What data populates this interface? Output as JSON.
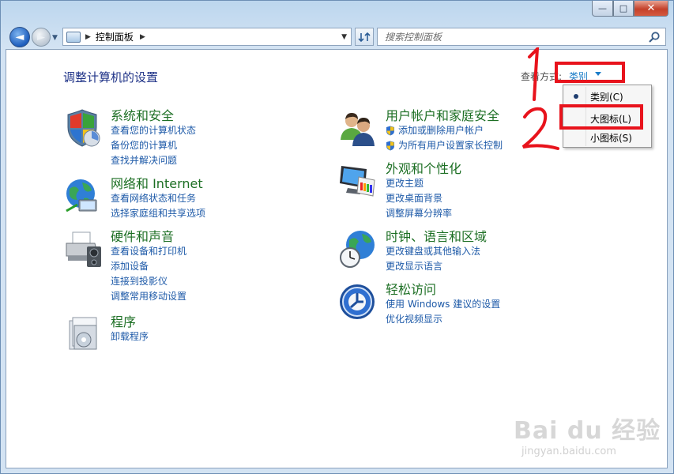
{
  "window": {
    "controls": {
      "minimize": "—",
      "maximize": "□",
      "close": "✕"
    }
  },
  "nav": {
    "back_glyph": "◄",
    "forward_glyph": "►",
    "dropdown_glyph": "▼"
  },
  "address": {
    "path": "控制面板",
    "separator": "▶",
    "dropdown": "▼"
  },
  "search": {
    "placeholder": "搜索控制面板"
  },
  "main": {
    "title": "调整计算机的设置",
    "view_by_label": "查看方式:",
    "view_by_value": "类别"
  },
  "categories": [
    {
      "title": "系统和安全",
      "icon": "shield-icon",
      "links": [
        "查看您的计算机状态",
        "备份您的计算机",
        "查找并解决问题"
      ]
    },
    {
      "title": "网络和 Internet",
      "icon": "network-globe-icon",
      "links": [
        "查看网络状态和任务",
        "选择家庭组和共享选项"
      ]
    },
    {
      "title": "硬件和声音",
      "icon": "printer-icon",
      "links": [
        "查看设备和打印机",
        "添加设备",
        "连接到投影仪",
        "调整常用移动设置"
      ]
    },
    {
      "title": "程序",
      "icon": "programs-icon",
      "links": [
        "卸载程序"
      ]
    },
    {
      "title": "用户帐户和家庭安全",
      "icon": "users-icon",
      "links": [
        "添加或删除用户帐户",
        "为所有用户设置家长控制"
      ]
    },
    {
      "title": "外观和个性化",
      "icon": "monitor-palette-icon",
      "links": [
        "更改主题",
        "更改桌面背景",
        "调整屏幕分辨率"
      ]
    },
    {
      "title": "时钟、语言和区域",
      "icon": "clock-globe-icon",
      "links": [
        "更改键盘或其他输入法",
        "更改显示语言"
      ]
    },
    {
      "title": "轻松访问",
      "icon": "accessibility-icon",
      "links": [
        "使用 Windows 建议的设置",
        "优化视频显示"
      ]
    }
  ],
  "dropdown_menu": {
    "items": [
      {
        "label": "类别(C)",
        "selected": true
      },
      {
        "label": "大图标(L)",
        "selected": false
      },
      {
        "label": "小图标(S)",
        "selected": false
      }
    ]
  },
  "annotations": {
    "step1": "1",
    "step2": "2",
    "color": "#e8131c"
  },
  "watermark": {
    "main": "Bai du 经验",
    "sub": "jingyan.baidu.com"
  }
}
